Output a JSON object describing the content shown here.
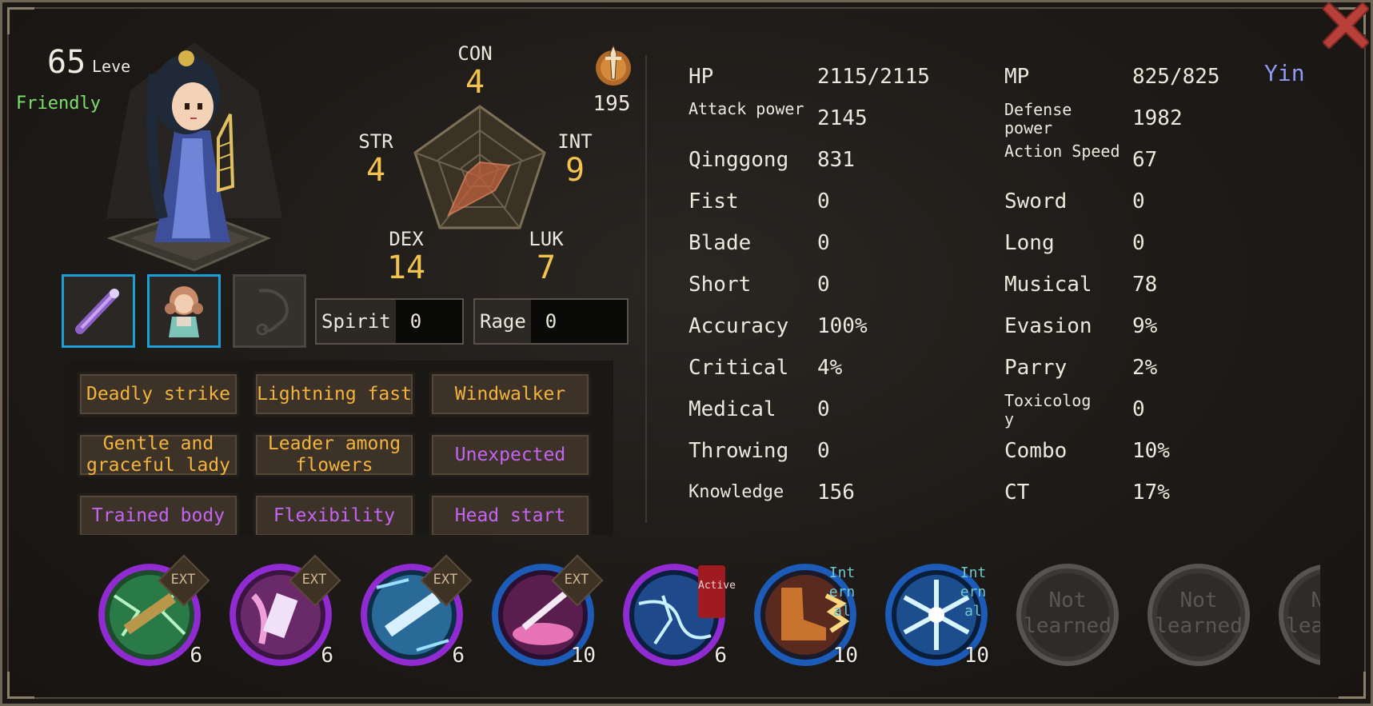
{
  "character": {
    "level": "65",
    "level_label": "Leve",
    "attitude": "Friendly"
  },
  "radar": {
    "con": {
      "label": "CON",
      "value": "4"
    },
    "str": {
      "label": "STR",
      "value": "4"
    },
    "int": {
      "label": "INT",
      "value": "9"
    },
    "dex": {
      "label": "DEX",
      "value": "14"
    },
    "luk": {
      "label": "LUK",
      "value": "7"
    }
  },
  "faction_value": "195",
  "gauges": {
    "spirit": {
      "label": "Spirit",
      "value": "0"
    },
    "rage": {
      "label": "Rage",
      "value": "0"
    }
  },
  "traits": [
    {
      "label": "Deadly strike",
      "color": "#f3b43e"
    },
    {
      "label": "Lightning fast",
      "color": "#f3b43e"
    },
    {
      "label": "Windwalker",
      "color": "#f3b43e"
    },
    {
      "label": "Gentle and graceful lady",
      "color": "#f3b43e"
    },
    {
      "label": "Leader among flowers",
      "color": "#f3b43e"
    },
    {
      "label": "Unexpected",
      "color": "#c465f2"
    },
    {
      "label": "Trained body",
      "color": "#c465f2"
    },
    {
      "label": "Flexibility",
      "color": "#c465f2"
    },
    {
      "label": "Head start",
      "color": "#c465f2"
    }
  ],
  "attributes": {
    "left": [
      {
        "label": "HP",
        "value": "2115/2115"
      },
      {
        "label": "Attack power",
        "value": "2145"
      },
      {
        "label": "Qinggong",
        "value": "831"
      },
      {
        "label": "Fist",
        "value": "0"
      },
      {
        "label": "Blade",
        "value": "0"
      },
      {
        "label": "Short",
        "value": "0"
      },
      {
        "label": "Accuracy",
        "value": "100%"
      },
      {
        "label": "Critical",
        "value": "4%"
      },
      {
        "label": "Medical",
        "value": "0"
      },
      {
        "label": "Throwing",
        "value": "0"
      },
      {
        "label": "Knowledge",
        "value": "156"
      }
    ],
    "right": [
      {
        "label": "MP",
        "value": "825/825"
      },
      {
        "label": "Defense power",
        "value": "1982"
      },
      {
        "label": "Action Speed",
        "value": "67"
      },
      {
        "label": "Sword",
        "value": "0"
      },
      {
        "label": "Long",
        "value": "0"
      },
      {
        "label": "Musical",
        "value": "78"
      },
      {
        "label": "Evasion",
        "value": "9%"
      },
      {
        "label": "Parry",
        "value": "2%"
      },
      {
        "label": "Toxicology",
        "value": "0"
      },
      {
        "label": "Combo",
        "value": "10%"
      },
      {
        "label": "CT",
        "value": "17%"
      }
    ],
    "yin_yang": "Yin"
  },
  "skills": [
    {
      "icon": "green-lightning-staff-icon",
      "tag": "EXT",
      "level": "6"
    },
    {
      "icon": "pink-wing-scroll-icon",
      "tag": "EXT",
      "level": "6"
    },
    {
      "icon": "blue-ice-blade-icon",
      "tag": "EXT",
      "level": "6"
    },
    {
      "icon": "pink-musical-strike-icon",
      "tag": "EXT",
      "level": "10"
    },
    {
      "icon": "blue-lightning-icon",
      "tag": "Active",
      "level": "6"
    },
    {
      "icon": "flaming-boot-icon",
      "tag": "Internal",
      "level": "10"
    },
    {
      "icon": "ice-crystal-icon",
      "tag": "Internal",
      "level": "10"
    },
    {
      "icon": "locked-slot-icon",
      "locked": "Not learned"
    },
    {
      "icon": "locked-slot-icon",
      "locked": "Not learned"
    },
    {
      "icon": "locked-slot-icon",
      "locked": "Not learned"
    }
  ]
}
